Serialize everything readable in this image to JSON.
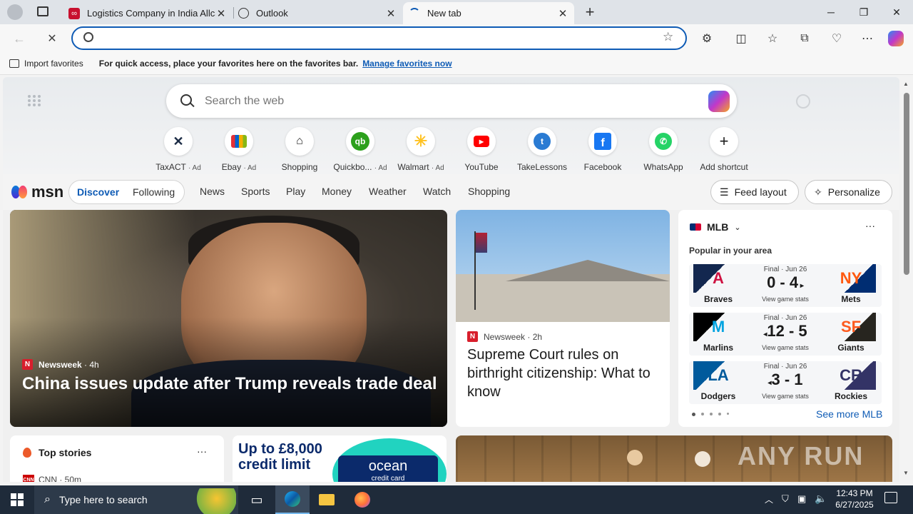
{
  "tabs": [
    {
      "title": "Logistics Company in India Allcargo",
      "favicon": "allcargo-icon",
      "color": "#c8102e"
    },
    {
      "title": "Outlook",
      "favicon": "globe-icon"
    },
    {
      "title": "New tab",
      "favicon": "loading-icon"
    }
  ],
  "favorites_bar": {
    "import_label": "Import favorites",
    "message": "For quick access, place your favorites here on the favorites bar.",
    "manage_link": "Manage favorites now"
  },
  "search": {
    "placeholder": "Search the web"
  },
  "shortcuts": [
    {
      "label": "TaxACT",
      "ad": "· Ad",
      "icon": "taxact-icon",
      "color": "#1a2a44"
    },
    {
      "label": "Ebay",
      "ad": "· Ad",
      "icon": "ebay-icon",
      "color": "#e53238"
    },
    {
      "label": "Shopping",
      "ad": "",
      "icon": "tag-icon",
      "color": "#222"
    },
    {
      "label": "Quickbo...",
      "ad": "· Ad",
      "icon": "quickbooks-icon",
      "color": "#2ca01c"
    },
    {
      "label": "Walmart",
      "ad": "· Ad",
      "icon": "walmart-icon",
      "color": "#0071ce"
    },
    {
      "label": "YouTube",
      "ad": "",
      "icon": "youtube-icon",
      "color": "#ff0000"
    },
    {
      "label": "TakeLessons",
      "ad": "",
      "icon": "takelessons-icon",
      "color": "#2a7bd3"
    },
    {
      "label": "Facebook",
      "ad": "",
      "icon": "facebook-icon",
      "color": "#1877f2"
    },
    {
      "label": "WhatsApp",
      "ad": "",
      "icon": "whatsapp-icon",
      "color": "#25d366"
    },
    {
      "label": "Add shortcut",
      "ad": "",
      "icon": "plus-icon",
      "color": "#333"
    }
  ],
  "msn": {
    "logo": "msn",
    "tabs": [
      "Discover",
      "Following"
    ],
    "nav": [
      "News",
      "Sports",
      "Play",
      "Money",
      "Weather",
      "Watch",
      "Shopping"
    ],
    "feed_layout": "Feed layout",
    "personalize": "Personalize"
  },
  "hero": {
    "source": "Newsweek",
    "age": "· 4h",
    "headline": "China issues update after Trump reveals trade deal"
  },
  "card2": {
    "source": "Newsweek",
    "age": "· 2h",
    "headline": "Supreme Court rules on birthright citizenship: What to know"
  },
  "mlb": {
    "title": "MLB",
    "subtitle": "Popular in your area",
    "see_more": "See more MLB",
    "games": [
      {
        "status": "Final · Jun 26",
        "home": "Braves",
        "away": "Mets",
        "score": "0 - 4",
        "stats": "View game stats",
        "home_mark": "A",
        "away_mark": "NY"
      },
      {
        "status": "Final · Jun 26",
        "home": "Marlins",
        "away": "Giants",
        "score": "12 - 5",
        "stats": "View game stats",
        "home_mark": "M",
        "away_mark": "SF"
      },
      {
        "status": "Final · Jun 26",
        "home": "Dodgers",
        "away": "Rockies",
        "score": "3 - 1",
        "stats": "View game stats",
        "home_mark": "LA",
        "away_mark": "CR"
      }
    ]
  },
  "top_stories": {
    "title": "Top stories",
    "source": "CNN",
    "age": "· 50m"
  },
  "ad": {
    "line1": "Up to £8,000",
    "line2": "credit limit",
    "brand": "ocean",
    "sub": "credit card"
  },
  "taskbar": {
    "search_placeholder": "Type here to search",
    "time": "12:43 PM",
    "date": "6/27/2025"
  },
  "watermark": "ANY RUN"
}
